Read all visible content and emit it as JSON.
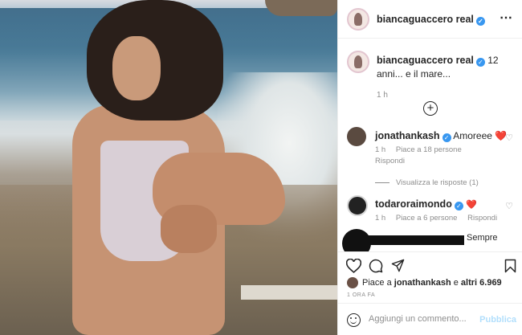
{
  "post": {
    "username": "biancaguaccero real",
    "verified_mark": "✓",
    "more_icon": "⋯"
  },
  "caption": {
    "username": "biancaguaccero real",
    "text": "12 anni... e il mare...",
    "time": "1 h"
  },
  "comments": [
    {
      "username": "jonathankash",
      "text": "Amoreee ❤️",
      "time": "1 h",
      "likes": "Piace a 18 persone",
      "reply": "Rispondi",
      "view_replies": "Visualizza le risposte (1)"
    },
    {
      "username": "todaroraimondo",
      "text": "❤️",
      "time": "1 h",
      "likes": "Piace a 6 persone",
      "reply": "Rispondi"
    },
    {
      "text": "Sempre"
    }
  ],
  "likes_bar": {
    "prefix": "Piace a",
    "user": "jonathankash",
    "middle": "e",
    "others": "altri 6.969",
    "time_ago": "1 ORA FA"
  },
  "composer": {
    "placeholder": "Aggiungi un commento...",
    "publish_label": "Pubblica"
  },
  "colors": {
    "verified": "#3897f0",
    "heart": "#ed1c3a",
    "publish_disabled": "#b2dffc"
  }
}
